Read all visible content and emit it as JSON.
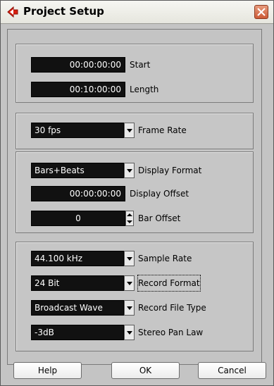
{
  "window": {
    "title": "Project Setup"
  },
  "timing": {
    "start_value": "00:00:00:00",
    "start_label": "Start",
    "length_value": "00:10:00:00",
    "length_label": "Length"
  },
  "frame": {
    "frame_rate_value": "30 fps",
    "frame_rate_label": "Frame Rate"
  },
  "display": {
    "format_value": "Bars+Beats",
    "format_label": "Display Format",
    "offset_value": "00:00:00:00",
    "offset_label": "Display Offset",
    "bar_offset_value": "0",
    "bar_offset_label": "Bar Offset"
  },
  "audio": {
    "sample_rate_value": "44.100 kHz",
    "sample_rate_label": "Sample Rate",
    "record_format_value": "24 Bit",
    "record_format_label": "Record Format",
    "record_file_type_value": "Broadcast Wave",
    "record_file_type_label": "Record File Type",
    "pan_law_value": "-3dB",
    "pan_law_label": "Stereo Pan Law"
  },
  "buttons": {
    "help": "Help",
    "ok": "OK",
    "cancel": "Cancel"
  },
  "icons": {
    "app": "cubase-arrow-icon",
    "close": "close-icon"
  },
  "colors": {
    "field_bg": "#111111",
    "field_text": "#ffffff",
    "dialog_bg": "#c4c4c4",
    "close_button": "#cc5a37",
    "app_icon": "#d91f0f"
  }
}
